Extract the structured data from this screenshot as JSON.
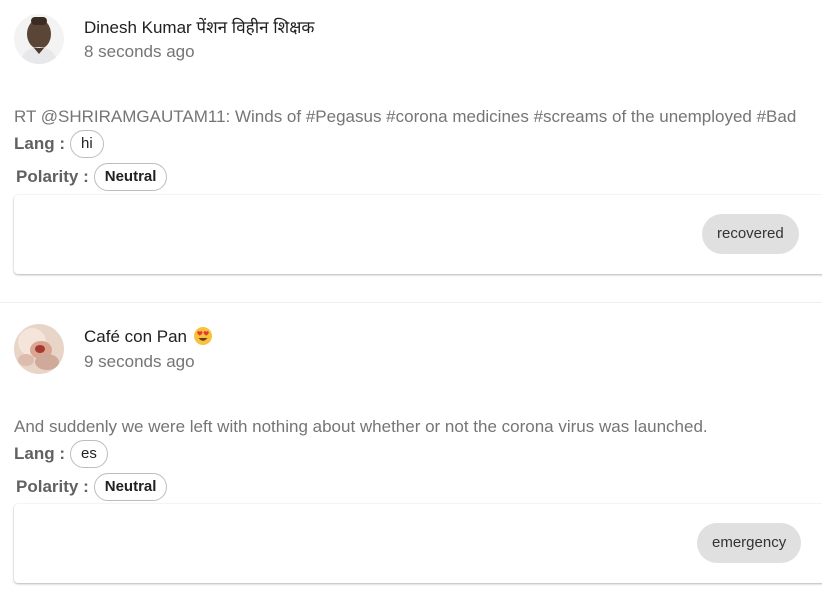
{
  "posts": [
    {
      "author": "Dinesh Kumar पेंशन विहीन शिक्षक",
      "time": "8 seconds ago",
      "text": "RT @SHRIRAMGAUTAM11: Winds of #Pegasus #corona medicines #screams of the unemployed #Bad",
      "lang_label": "Lang :",
      "lang": "hi",
      "polarity_label": "Polarity :",
      "polarity": "Neutral",
      "category": "recovered",
      "avatar_icon": "person-photo-icon"
    },
    {
      "author": "Café con Pan",
      "author_emoji_icon": "heart-eyes-emoji-icon",
      "time": "9 seconds ago",
      "text": "And suddenly we were left with nothing about whether or not the corona virus was launched.",
      "lang_label": "Lang :",
      "lang": "es",
      "polarity_label": "Polarity :",
      "polarity": "Neutral",
      "category": "emergency",
      "avatar_icon": "photo-avatar-icon"
    }
  ],
  "colors": {
    "secondary_text": "#757575",
    "chip_border": "#bdbdbd",
    "category_chip_bg": "#e0e0e0"
  }
}
